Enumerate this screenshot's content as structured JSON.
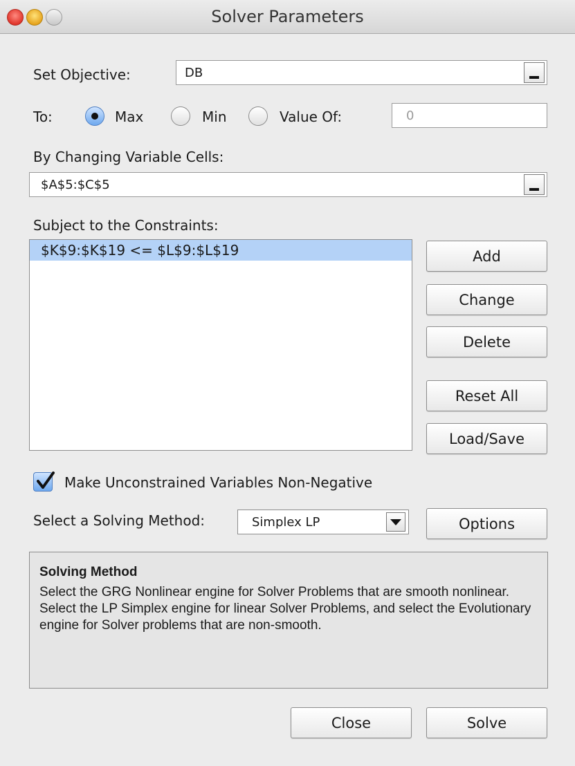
{
  "window": {
    "title": "Solver Parameters"
  },
  "objective": {
    "label": "Set Objective:",
    "value": "DB"
  },
  "to": {
    "label": "To:",
    "options": [
      {
        "label": "Max",
        "selected": true
      },
      {
        "label": "Min",
        "selected": false
      },
      {
        "label": "Value Of:",
        "selected": false
      }
    ],
    "value_of": "0"
  },
  "variables": {
    "label": "By Changing Variable Cells:",
    "value": "$A$5:$C$5"
  },
  "constraints": {
    "label": "Subject to the Constraints:",
    "items": [
      "$K$9:$K$19 <= $L$9:$L$19"
    ]
  },
  "buttons": {
    "add": "Add",
    "change": "Change",
    "delete": "Delete",
    "reset_all": "Reset All",
    "load_save": "Load/Save",
    "options": "Options",
    "close": "Close",
    "solve": "Solve"
  },
  "nonnegative": {
    "label": "Make Unconstrained Variables Non-Negative",
    "checked": true
  },
  "method": {
    "label": "Select a Solving Method:",
    "selected": "Simplex LP"
  },
  "info": {
    "title": "Solving Method",
    "text": "Select the GRG Nonlinear engine for Solver Problems that are smooth nonlinear. Select the LP Simplex engine for linear Solver Problems, and select the Evolutionary engine for Solver problems that are non-smooth."
  },
  "colors": {
    "selection": "#b4d2f7",
    "accent": "#6ea8ee"
  }
}
